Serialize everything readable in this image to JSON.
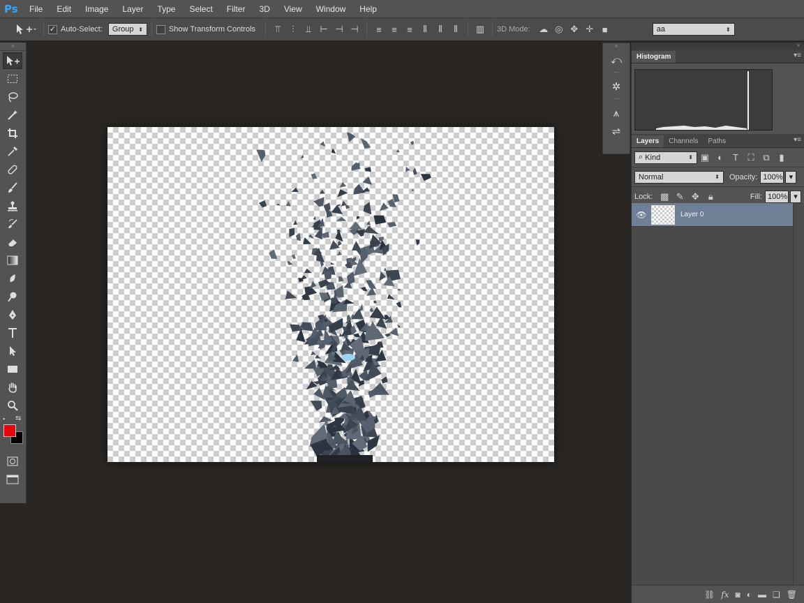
{
  "app": {
    "logo": "Ps"
  },
  "menu": [
    "File",
    "Edit",
    "Image",
    "Layer",
    "Type",
    "Select",
    "Filter",
    "3D",
    "View",
    "Window",
    "Help"
  ],
  "options": {
    "auto_select_label": "Auto-Select:",
    "auto_select_checked": true,
    "auto_select_value": "Group",
    "transform_label": "Show Transform Controls",
    "transform_checked": false,
    "mode_label": "3D Mode:",
    "workspace_value": "aa"
  },
  "panels": {
    "histogram_tab": "Histogram",
    "layers_tabs": [
      "Layers",
      "Channels",
      "Paths"
    ],
    "filter_value": "Kind",
    "blend_value": "Normal",
    "opacity_label": "Opacity:",
    "opacity_value": "100%",
    "lock_label": "Lock:",
    "fill_label": "Fill:",
    "fill_value": "100%",
    "layer_name": "Layer 0"
  },
  "colors": {
    "foreground": "#e8000b",
    "background": "#000000",
    "accent": "#31a8ff",
    "selected_layer": "#6e7f96"
  },
  "icons": {
    "tools": [
      "move-tool",
      "marquee-tool",
      "lasso-tool",
      "magic-wand-tool",
      "crop-tool",
      "eyedropper-tool",
      "healing-brush-tool",
      "brush-tool",
      "clone-stamp-tool",
      "history-brush-tool",
      "eraser-tool",
      "gradient-tool",
      "blur-tool",
      "dodge-tool",
      "pen-tool",
      "type-tool",
      "path-selection-tool",
      "rectangle-tool",
      "hand-tool",
      "zoom-tool"
    ]
  }
}
